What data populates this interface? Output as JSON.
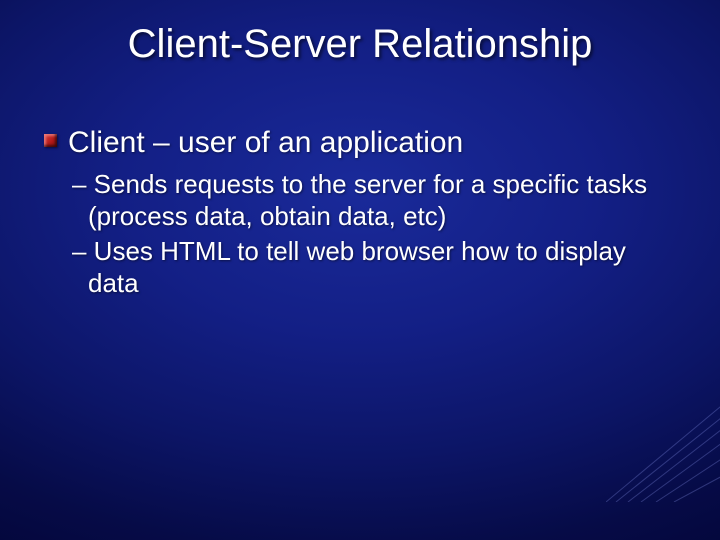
{
  "title": "Client-Server Relationship",
  "lvl1_text": "Client – user of an application",
  "sub1": "– Sends requests to the server for a specific tasks (process data, obtain data, etc)",
  "sub2": "– Uses HTML to tell web browser how to display data"
}
